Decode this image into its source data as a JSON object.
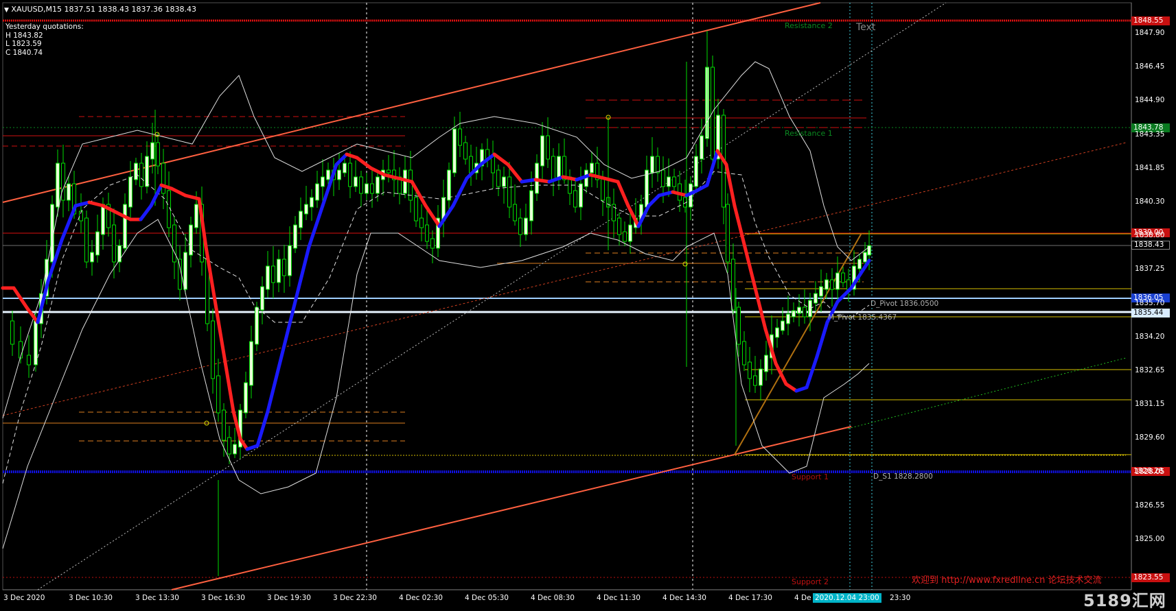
{
  "header": {
    "symbol_info": "XAUUSD,M15  1837.51 1838.43 1837.36 1838.43"
  },
  "yesterday": {
    "title": "Yesterday quotations:",
    "high": "H 1843.82",
    "low": "L 1823.59",
    "close": "C 1840.74"
  },
  "price_axis": {
    "ticks": [
      "1847.90",
      "1846.45",
      "1844.90",
      "1843.35",
      "1841.85",
      "1840.30",
      "1838.80",
      "1837.25",
      "1835.70",
      "1834.20",
      "1832.65",
      "1831.15",
      "1829.60",
      "1828.05",
      "1826.55",
      "1825.00"
    ],
    "boxes": {
      "r2": "1848.55",
      "r1": "1843.78",
      "res": "1839.00",
      "current": "1838.43",
      "pivot": "1836.05",
      "m_pivot": "1835.44",
      "s1": "1828.28",
      "s2": "1823.55"
    }
  },
  "time_axis": {
    "labels": [
      "3 Dec 2020",
      "3 Dec 10:30",
      "3 Dec 13:30",
      "3 Dec 16:30",
      "3 Dec 19:30",
      "3 Dec 22:30",
      "4 Dec 02:30",
      "4 Dec 05:30",
      "4 Dec 08:30",
      "4 Dec 11:30",
      "4 Dec 14:30",
      "4 Dec 17:30",
      "4 De",
      "23:30"
    ],
    "cursor": "2020.12.04 23:00"
  },
  "levels": {
    "resistance2": "Resistance 2",
    "resistance1": "Resistance 1",
    "support1": "Support 1",
    "support2": "Support 2",
    "d_pivot": "D_Pivot 1836.0500",
    "m_pivot": "M_Pivot 1835.4367",
    "d_s1": "D_S1 1828.2800",
    "text_obj": "Text"
  },
  "watermark": "欢迎到 http://www.fxredline.cn 论坛技术交流",
  "logo": "5189汇网",
  "colors": {
    "background": "#000000",
    "bull_candle": "#e8ffd8",
    "wick": "#00dd00",
    "ma_up": "#1a1aff",
    "ma_down": "#ff2020",
    "bands": "#e0e0e0",
    "channel": "#ff6040",
    "resistance": "#dd1010",
    "support": "#1010dd",
    "pivot_line": "#a0d0ff",
    "level_gold": "#d8c000",
    "level_orange": "#e08020"
  }
}
